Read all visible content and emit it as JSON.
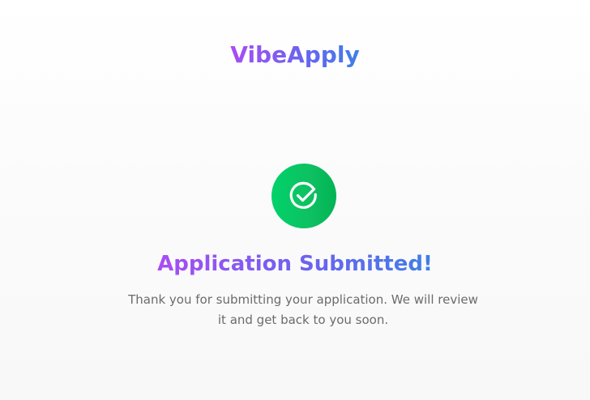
{
  "brand": {
    "name": "VibeApply"
  },
  "status": {
    "icon": "check-circle-icon",
    "title": "Application Submitted!",
    "message": "Thank you for submitting your application. We will review it and get back to you soon."
  },
  "colors": {
    "gradient_start": "#a94cf4",
    "gradient_end": "#3f7fe8",
    "success": "#00c760",
    "text_muted": "#6b6b6b"
  }
}
